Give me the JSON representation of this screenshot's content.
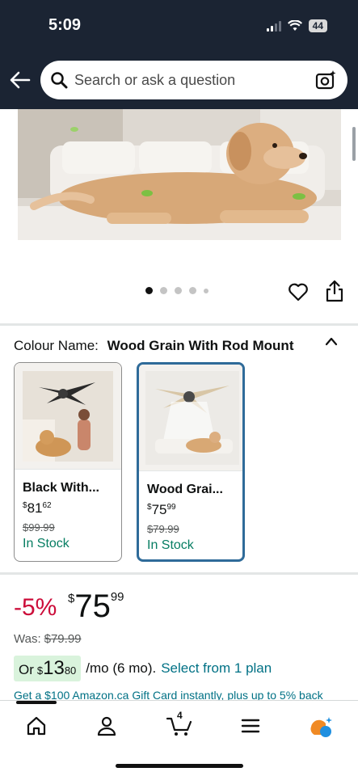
{
  "status_bar": {
    "time": "5:09",
    "battery": "44"
  },
  "search": {
    "placeholder": "Search or ask a question"
  },
  "gallery": {
    "dot_count": 5,
    "active_index": 0
  },
  "colour": {
    "label": "Colour Name:",
    "value": "Wood Grain With Rod Mount"
  },
  "variants": [
    {
      "name": "Black With...",
      "price_symbol": "$",
      "price_whole": "81",
      "price_fraction": "62",
      "was": "$99.99",
      "stock": "In Stock",
      "selected": false
    },
    {
      "name": "Wood Grai...",
      "price_symbol": "$",
      "price_whole": "75",
      "price_fraction": "99",
      "was": "$79.99",
      "stock": "In Stock",
      "selected": true
    }
  ],
  "pricing": {
    "discount": "-5%",
    "symbol": "$",
    "whole": "75",
    "fraction": "99",
    "was_label": "Was:",
    "was_price": "$79.99"
  },
  "plan": {
    "or": "Or",
    "symbol": "$",
    "whole": "13",
    "fraction": "80",
    "rate": "/mo (6 mo).",
    "link": "Select from 1 plan"
  },
  "gift_card": "Get a $100 Amazon.ca Gift Card instantly, plus up to 5% back",
  "bottom_nav": {
    "items": [
      "home-icon",
      "account-icon",
      "cart-icon",
      "menu-icon",
      "rufus-icon"
    ],
    "cart_count": "4"
  },
  "colors": {
    "header": "#1b2433",
    "price_red": "#cc0c39",
    "link": "#007185",
    "stock_green": "#067d62",
    "selected_border": "#2f6b99"
  }
}
